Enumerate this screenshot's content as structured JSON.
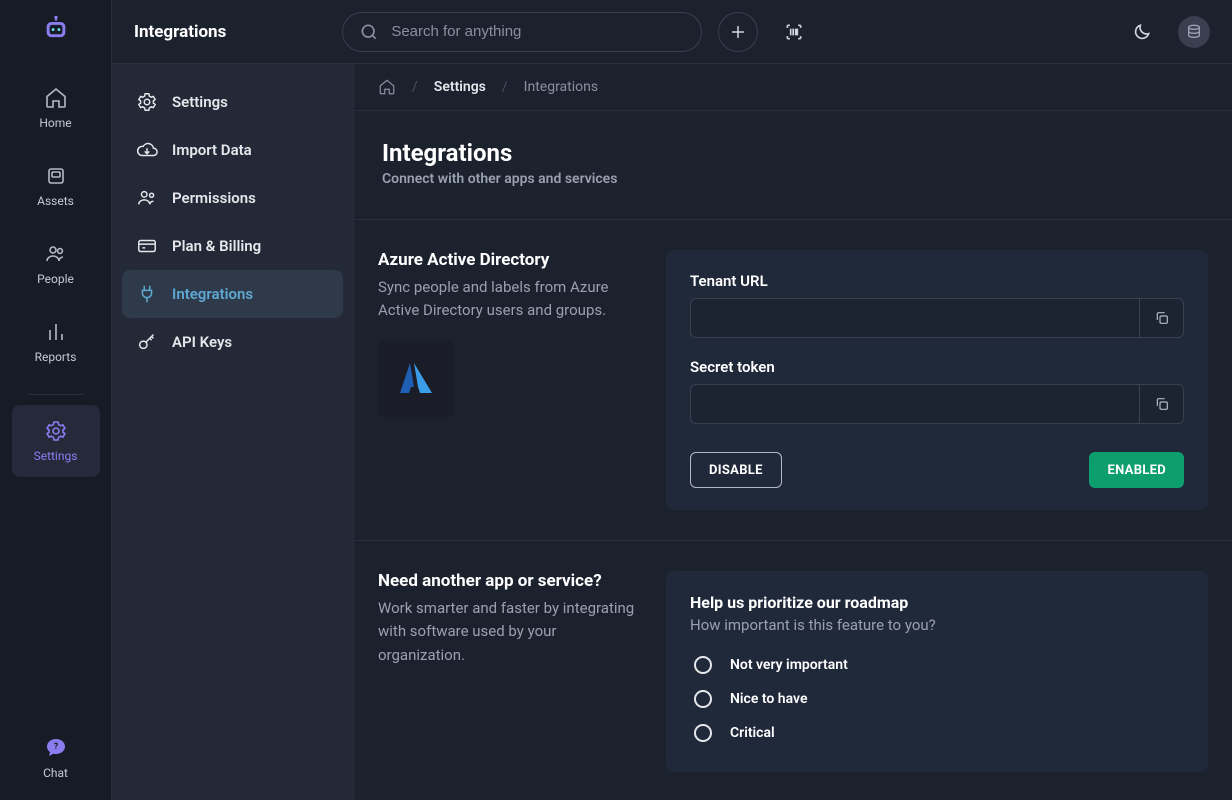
{
  "header": {
    "title": "Integrations",
    "search_placeholder": "Search for anything"
  },
  "rail": {
    "items": [
      {
        "label": "Home"
      },
      {
        "label": "Assets"
      },
      {
        "label": "People"
      },
      {
        "label": "Reports"
      },
      {
        "label": "Settings"
      }
    ],
    "footer": {
      "label": "Chat"
    }
  },
  "sidebar": {
    "items": [
      {
        "label": "Settings"
      },
      {
        "label": "Import Data"
      },
      {
        "label": "Permissions"
      },
      {
        "label": "Plan & Billing"
      },
      {
        "label": "Integrations"
      },
      {
        "label": "API Keys"
      }
    ]
  },
  "breadcrumb": {
    "link": "Settings",
    "current": "Integrations"
  },
  "page": {
    "title": "Integrations",
    "subtitle": "Connect with other apps and services"
  },
  "azure": {
    "title": "Azure Active Directory",
    "desc": "Sync people and labels from Azure Active Directory users and groups.",
    "tenant_label": "Tenant URL",
    "secret_label": "Secret token",
    "disable": "DISABLE",
    "enabled": "ENABLED"
  },
  "request": {
    "title": "Need another app or service?",
    "desc": "Work smarter and faster by integrating with software used by your organization."
  },
  "roadmap": {
    "title": "Help us prioritize our roadmap",
    "question": "How important is this feature to you?",
    "options": [
      "Not very important",
      "Nice to have",
      "Critical"
    ]
  }
}
